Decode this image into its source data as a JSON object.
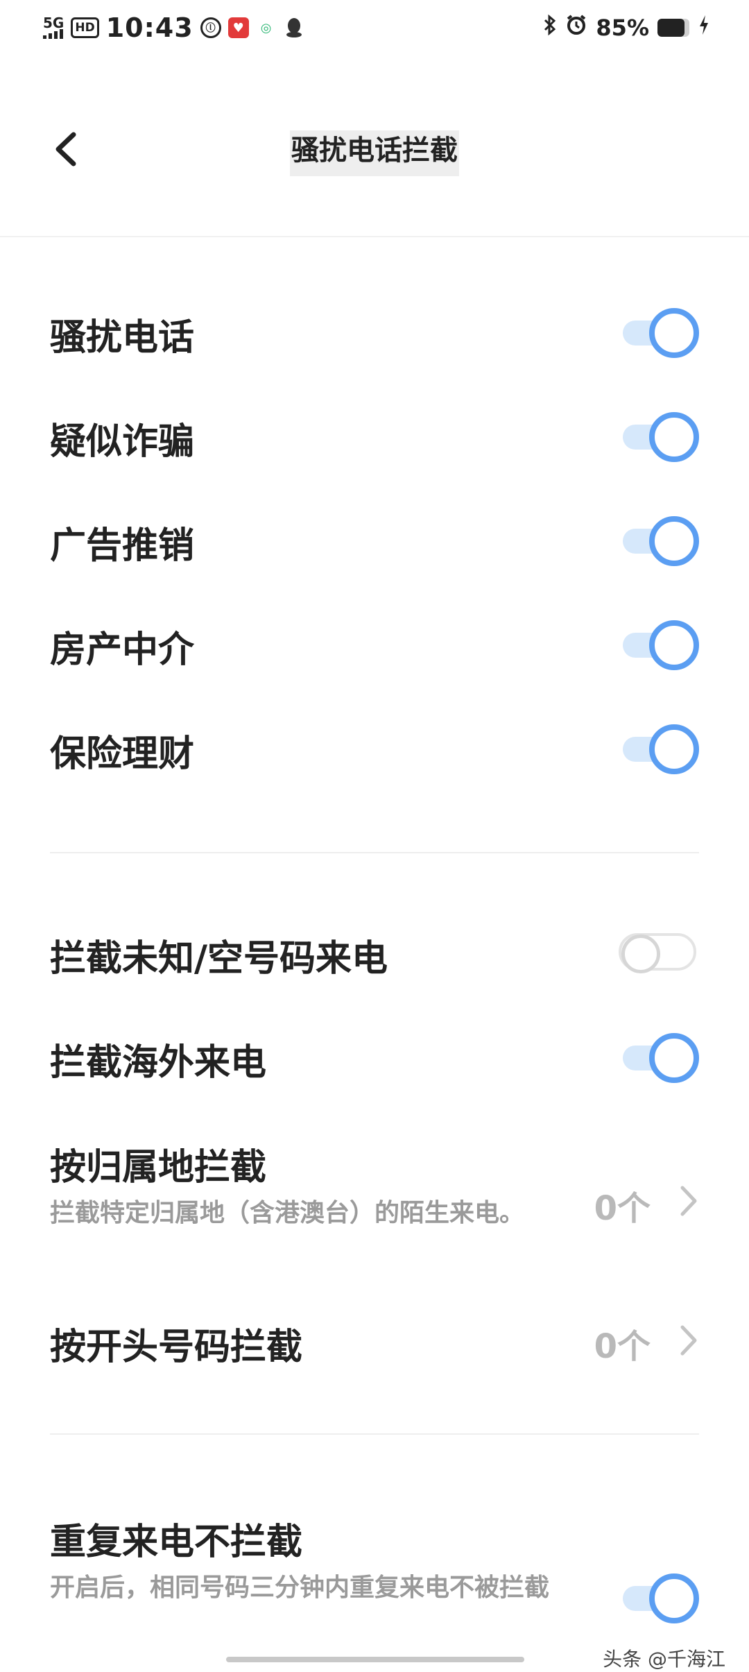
{
  "status_bar": {
    "network": "5G",
    "hd": "HD",
    "time": "10:43",
    "battery_percent": "85%",
    "battery_level": 0.85,
    "icons": [
      "signal-icon",
      "bluetooth-icon",
      "alarm-icon",
      "battery-icon",
      "charging-icon"
    ]
  },
  "header": {
    "title": "骚扰电话拦截"
  },
  "category_section": {
    "items": [
      {
        "label": "骚扰电话",
        "on": true
      },
      {
        "label": "疑似诈骗",
        "on": true
      },
      {
        "label": "广告推销",
        "on": true
      },
      {
        "label": "房产中介",
        "on": true
      },
      {
        "label": "保险理财",
        "on": true
      }
    ]
  },
  "block_section": {
    "unknown": {
      "label": "拦截未知/空号码来电",
      "on": false
    },
    "overseas": {
      "label": "拦截海外来电",
      "on": true
    },
    "by_region": {
      "label": "按归属地拦截",
      "description": "拦截特定归属地（含港澳台）的陌生来电。",
      "value": "0个"
    },
    "by_prefix": {
      "label": "按开头号码拦截",
      "value": "0个"
    }
  },
  "repeat_section": {
    "label": "重复来电不拦截",
    "description": "开启后，相同号码三分钟内重复来电不被拦截",
    "on": true
  },
  "watermark": "头条 @千海江",
  "colors": {
    "toggle_on": "#5b9ef2",
    "toggle_track_on": "#d6e8fb",
    "toggle_off": "#d6d6d6"
  }
}
